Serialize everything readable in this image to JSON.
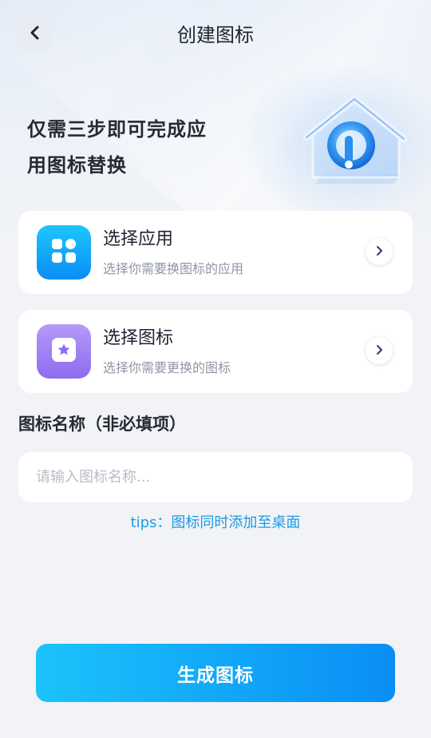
{
  "header": {
    "title": "创建图标",
    "back_icon": "chevron-left-icon"
  },
  "hero": {
    "headline_line1": "仅需三步即可完成应",
    "headline_line2": "用图标替换",
    "illustration": "house-icon-illustration"
  },
  "steps": [
    {
      "title": "选择应用",
      "subtitle": "选择你需要换图标的应用",
      "icon": "apps-grid-icon",
      "tile_color": "#0a8df5"
    },
    {
      "title": "选择图标",
      "subtitle": "选择你需要更换的图标",
      "icon": "star-badge-icon",
      "tile_color": "#8d6bf0"
    }
  ],
  "name_field": {
    "label": "图标名称（非必填项）",
    "placeholder": "请输入图标名称...",
    "value": ""
  },
  "tips": "tips：图标同时添加至桌面",
  "generate_button": "生成图标",
  "colors": {
    "accent": "#0a8ef5",
    "tips": "#1b9ae6",
    "background": "#f1f3f6"
  }
}
